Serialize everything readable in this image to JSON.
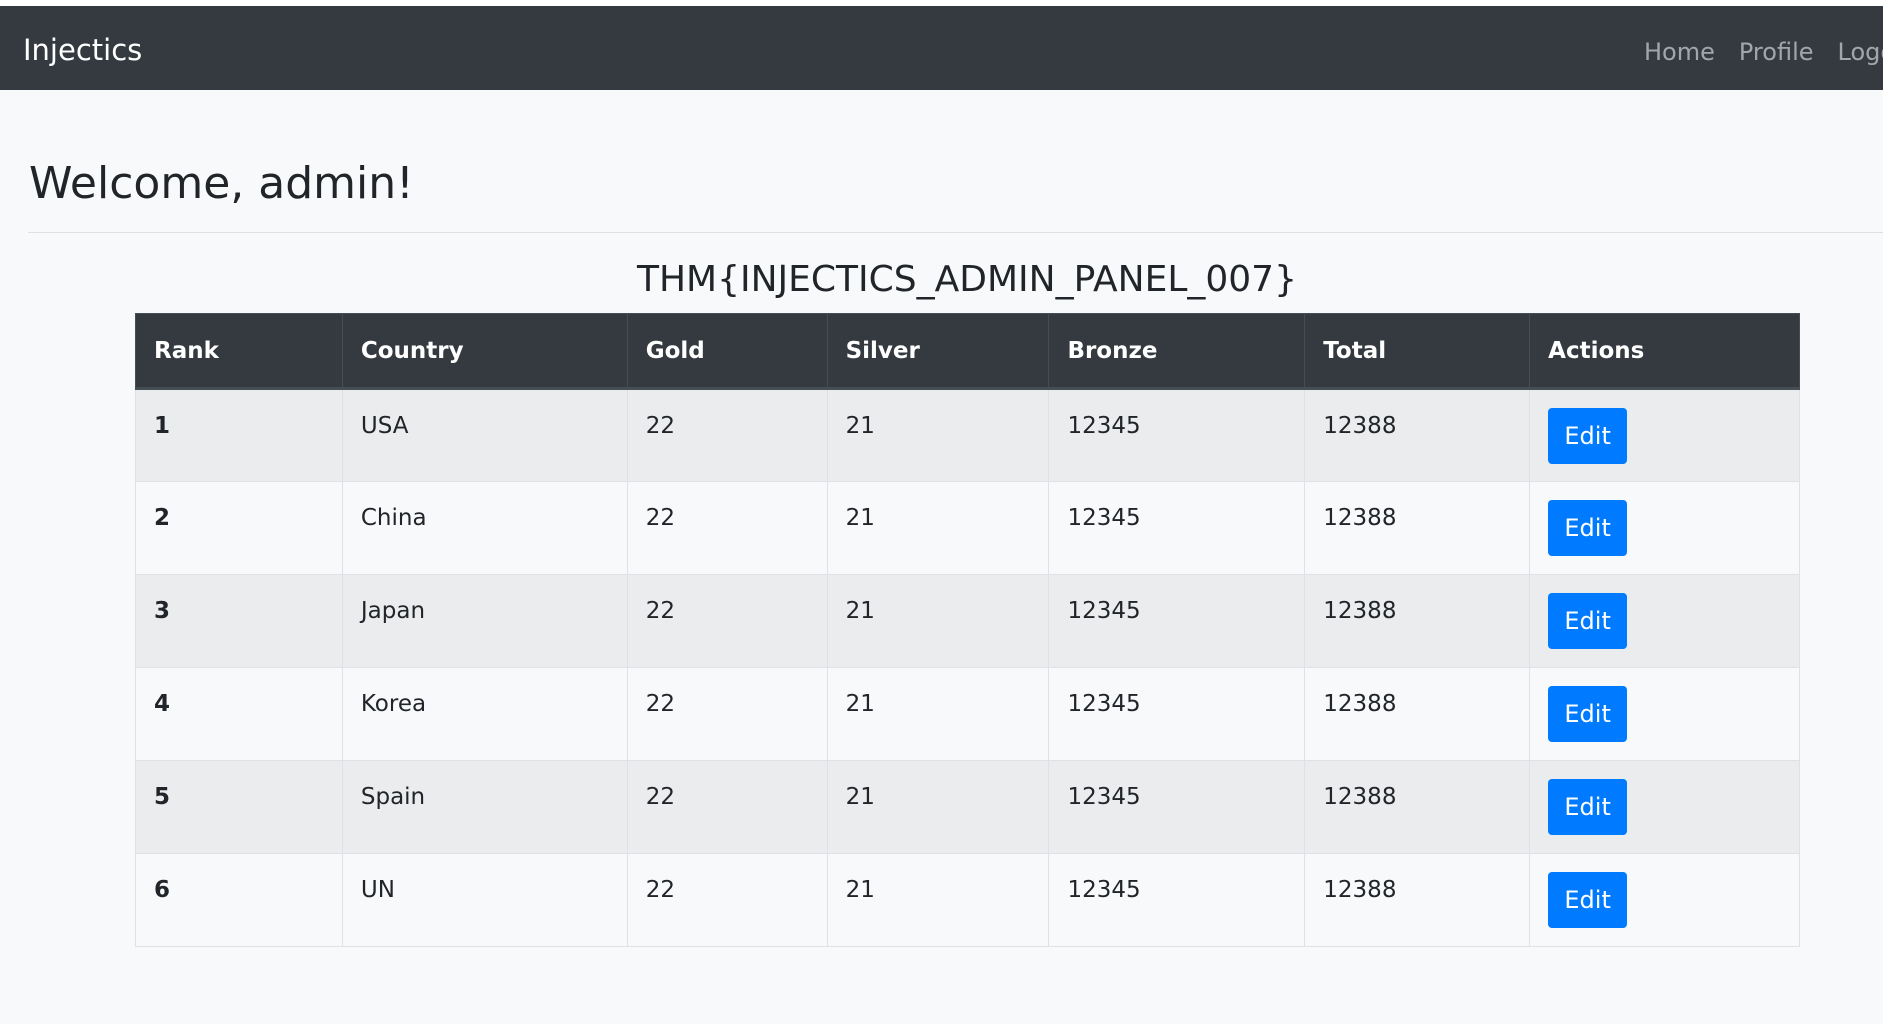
{
  "navbar": {
    "brand": "Injectics",
    "links": [
      "Home",
      "Profile",
      "Logout"
    ]
  },
  "page": {
    "welcome": "Welcome, admin!",
    "flag": "THM{INJECTICS_ADMIN_PANEL_007}"
  },
  "table": {
    "headers": [
      "Rank",
      "Country",
      "Gold",
      "Silver",
      "Bronze",
      "Total",
      "Actions"
    ],
    "edit_label": "Edit",
    "rows": [
      {
        "rank": "1",
        "country": "USA",
        "gold": "22",
        "silver": "21",
        "bronze": "12345",
        "total": "12388"
      },
      {
        "rank": "2",
        "country": "China",
        "gold": "22",
        "silver": "21",
        "bronze": "12345",
        "total": "12388"
      },
      {
        "rank": "3",
        "country": "Japan",
        "gold": "22",
        "silver": "21",
        "bronze": "12345",
        "total": "12388"
      },
      {
        "rank": "4",
        "country": "Korea",
        "gold": "22",
        "silver": "21",
        "bronze": "12345",
        "total": "12388"
      },
      {
        "rank": "5",
        "country": "Spain",
        "gold": "22",
        "silver": "21",
        "bronze": "12345",
        "total": "12388"
      },
      {
        "rank": "6",
        "country": "UN",
        "gold": "22",
        "silver": "21",
        "bronze": "12345",
        "total": "12388"
      }
    ]
  },
  "colors": {
    "navbar_bg": "#343a40",
    "button_primary": "#007bff",
    "page_bg": "#f8f9fa"
  }
}
